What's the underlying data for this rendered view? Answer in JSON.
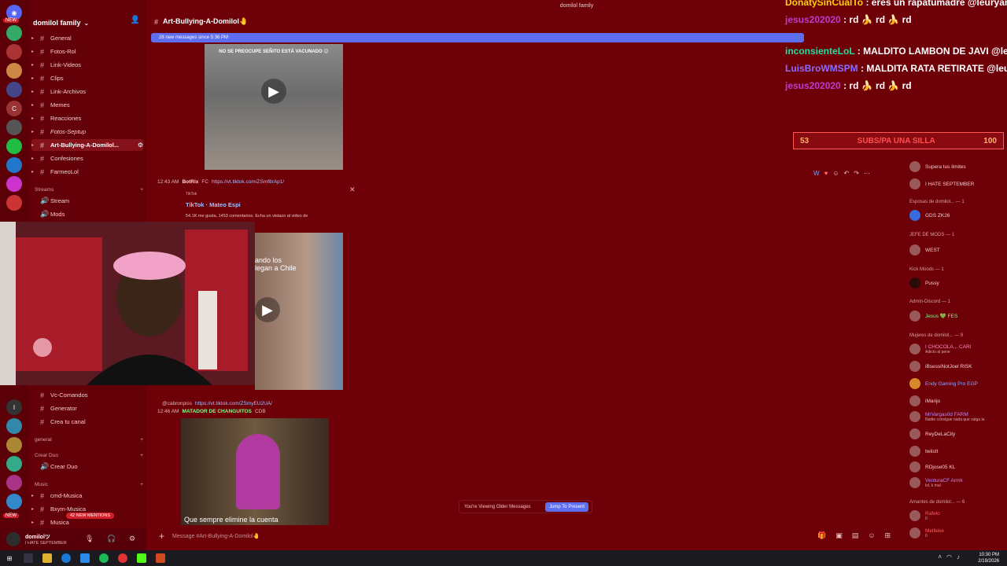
{
  "window": {
    "title": "domilol family"
  },
  "server": {
    "name": "domilol family"
  },
  "colors": {
    "accent": "#5d6ef0",
    "background": "#6e0008",
    "link": "#9fc0ff",
    "goal_text": "#ff5050"
  },
  "server_rail": {
    "badges": [
      "NEW",
      "42",
      "2",
      "75",
      "36",
      "18",
      "NEW",
      "12",
      "733",
      "10",
      "708",
      "NEW"
    ]
  },
  "sidebar": {
    "channels": [
      {
        "label": "General"
      },
      {
        "label": "Fotos-Rol"
      },
      {
        "label": "Link-Videos"
      },
      {
        "label": "Clips"
      },
      {
        "label": "Link-Archivos"
      },
      {
        "label": "Memes"
      },
      {
        "label": "Reacciones"
      },
      {
        "label": "Fotos-Septup"
      },
      {
        "label": "Art-Bullying-A-Domilol..."
      },
      {
        "label": "Confesiones"
      },
      {
        "label": "FarmeoLol"
      }
    ],
    "category_streams": "Streams",
    "streams_channels": [
      {
        "label": "Stream"
      },
      {
        "label": "Mods"
      }
    ],
    "lower_channels": [
      {
        "label": "Vc-Comandos"
      },
      {
        "label": "Generator"
      },
      {
        "label": "Crea tu canal"
      }
    ],
    "category_general": "general",
    "category_crear_duo": "Crear Duo",
    "crear_duo_channel": "Crear Duo",
    "category_music": "Music",
    "music_channels": [
      {
        "label": "cmd-Musica"
      },
      {
        "label": "Bxym-Musica"
      },
      {
        "label": "Musica"
      }
    ],
    "new_mentions": "42 NEW MENTIONS"
  },
  "user_panel": {
    "name": "domilolツ",
    "status": "I HATE SEPTEMBER"
  },
  "header": {
    "channel_name": "Art-Bullying-A-Domilol🤚"
  },
  "new_messages_banner": "28 new messages since 5:36 PM",
  "messages": {
    "video1_caption": "NO SE PREOCUPE SEÑITO ESTÁ VACUNADO 😊",
    "msg2": {
      "time": "12:43 AM",
      "author": "BotRix",
      "tag": "FC",
      "link": "https://vt.tiktok.com/ZSmf8rAp1/"
    },
    "embed": {
      "site": "TikTok",
      "title": "TikTok · Mateo Espi",
      "desc": "54.1K me gusta, 1453 comentarios. Echa un vistazo al video de"
    },
    "video2_text": "ando los\nlegan a Chile",
    "msg3": {
      "reply": "@cabronpiss",
      "time": "12:46 AM",
      "author": "MATADOR DE CHANGUITOS",
      "tag": "CDB",
      "link": "https://vt.tiktok.com/ZSmyEU2UA/"
    },
    "video3_caption": "Que sempre elimine la cuenta"
  },
  "viewing_bar": {
    "text": "You're Viewing Older Messages",
    "button": "Jump To Present"
  },
  "message_input": {
    "placeholder": "Message #Art-Bullying-A-Domilol🤚"
  },
  "overlay_chat": [
    {
      "user": "DonatySinCualTo",
      "text": ": eres un rapatumadre @leuryand",
      "color": "#ffd200"
    },
    {
      "user": "jesus202020",
      "text": ": rd 🍌 rd 🍌 rd",
      "color": "#c03acf"
    },
    {
      "user": "inconsienteLoL",
      "text": ": MALDITO LAMBON DE JAVI @leur",
      "color": "#1fe0a0"
    },
    {
      "user": "LuisBroWMSPM",
      "text": ": MALDITA RATA RETIRATE @leury",
      "color": "#8b6cff"
    },
    {
      "user": "jesus202020",
      "text": ": rd 🍌 rd 🍌 rd",
      "color": "#c03acf"
    }
  ],
  "goal": {
    "current": "53",
    "label": "SUBS/PA UNA SILLA",
    "target": "100"
  },
  "members": {
    "top_items": [
      {
        "name": "Supera tus limites",
        "sub": ""
      },
      {
        "name": "I HATE SEPTEMBER",
        "sub": ""
      }
    ],
    "categories": [
      {
        "label": "Esposas de domilol... — 1"
      },
      {
        "label": "JEFE DE MODS — 1"
      },
      {
        "label": "Kick Moods — 1"
      },
      {
        "label": "Admin-Discord — 1"
      },
      {
        "label": "Mujeres de domilol... — 9"
      },
      {
        "label": "Amantes de domilol... — 6"
      }
    ],
    "esposas": [
      {
        "name": "GDS ZK26",
        "sub": ""
      }
    ],
    "jefe": [
      {
        "name": "WEST",
        "sub": ""
      }
    ],
    "kick": [
      {
        "name": "Pussy",
        "sub": ""
      }
    ],
    "admin": [
      {
        "name": "Jesus 💚 FES",
        "sub": ""
      }
    ],
    "mujeres": [
      {
        "name": "I CHOCOLA... CARI",
        "sub": "Adicto al pene"
      },
      {
        "name": "iBsessiNotJoel RISK",
        "sub": ""
      },
      {
        "name": "Endy Gaming Pro EGP",
        "sub": ""
      },
      {
        "name": "iMarijo",
        "sub": ""
      },
      {
        "name": "MrVargas0d FARM",
        "sub": "Nadie consigue nada que valga la"
      },
      {
        "name": "ReyDeLaCity",
        "sub": ""
      },
      {
        "name": "twiistt",
        "sub": ""
      },
      {
        "name": "RDjose05 KL",
        "sub": ""
      },
      {
        "name": "VenturaCF Armk",
        "sub": "lol, k mal"
      }
    ],
    "amantes": [
      {
        "name": "Rafelo",
        "sub": "0"
      },
      {
        "name": "Mellleke",
        "sub": "0"
      }
    ]
  },
  "taskbar": {
    "time": "10:30 PM",
    "date": "2/19/2026"
  }
}
